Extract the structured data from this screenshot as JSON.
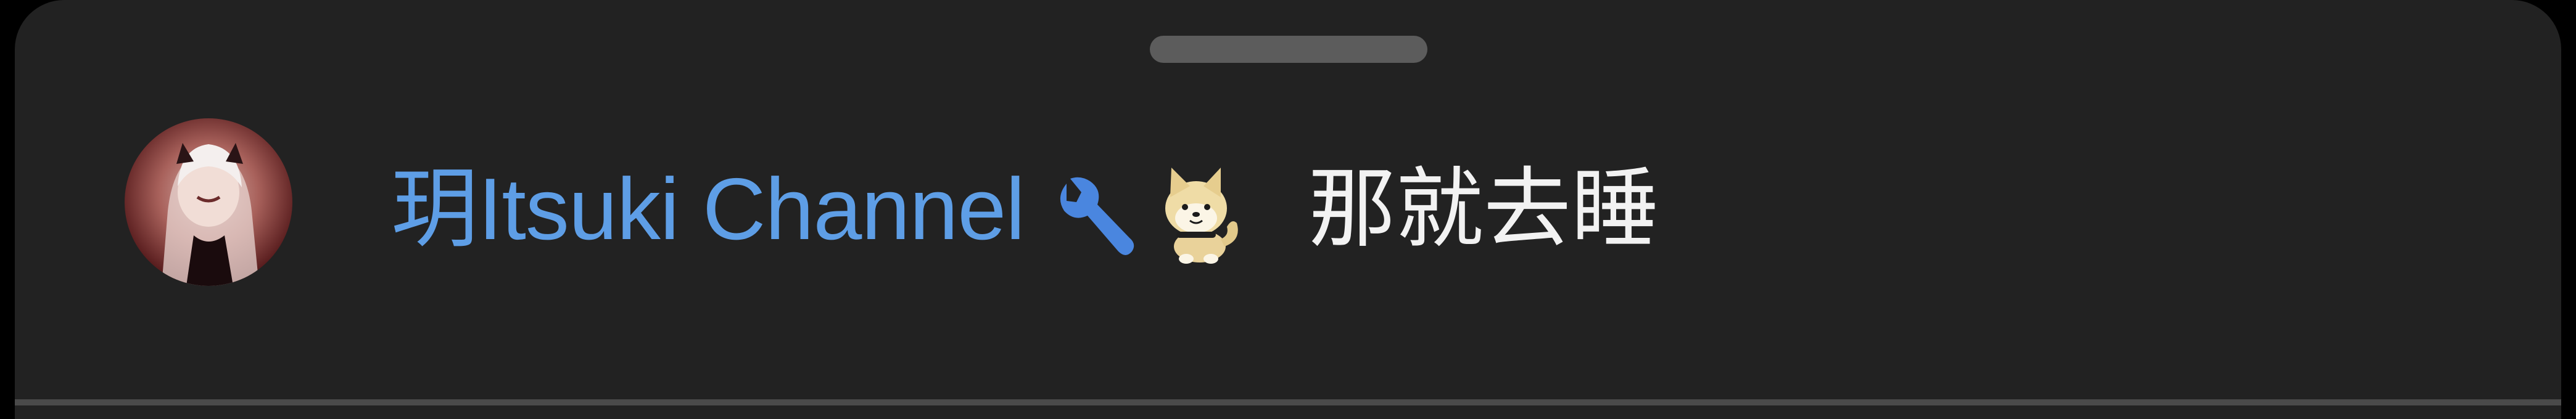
{
  "comment": {
    "author": "玥Itsuki Channel",
    "message": "那就去睡",
    "badges": [
      "wrench-icon",
      "shiba-dog-emoji"
    ]
  },
  "colors": {
    "background": "#222222",
    "author": "#5e9ee6",
    "message": "#f2f2f2",
    "handle": "#5c5c5c"
  }
}
